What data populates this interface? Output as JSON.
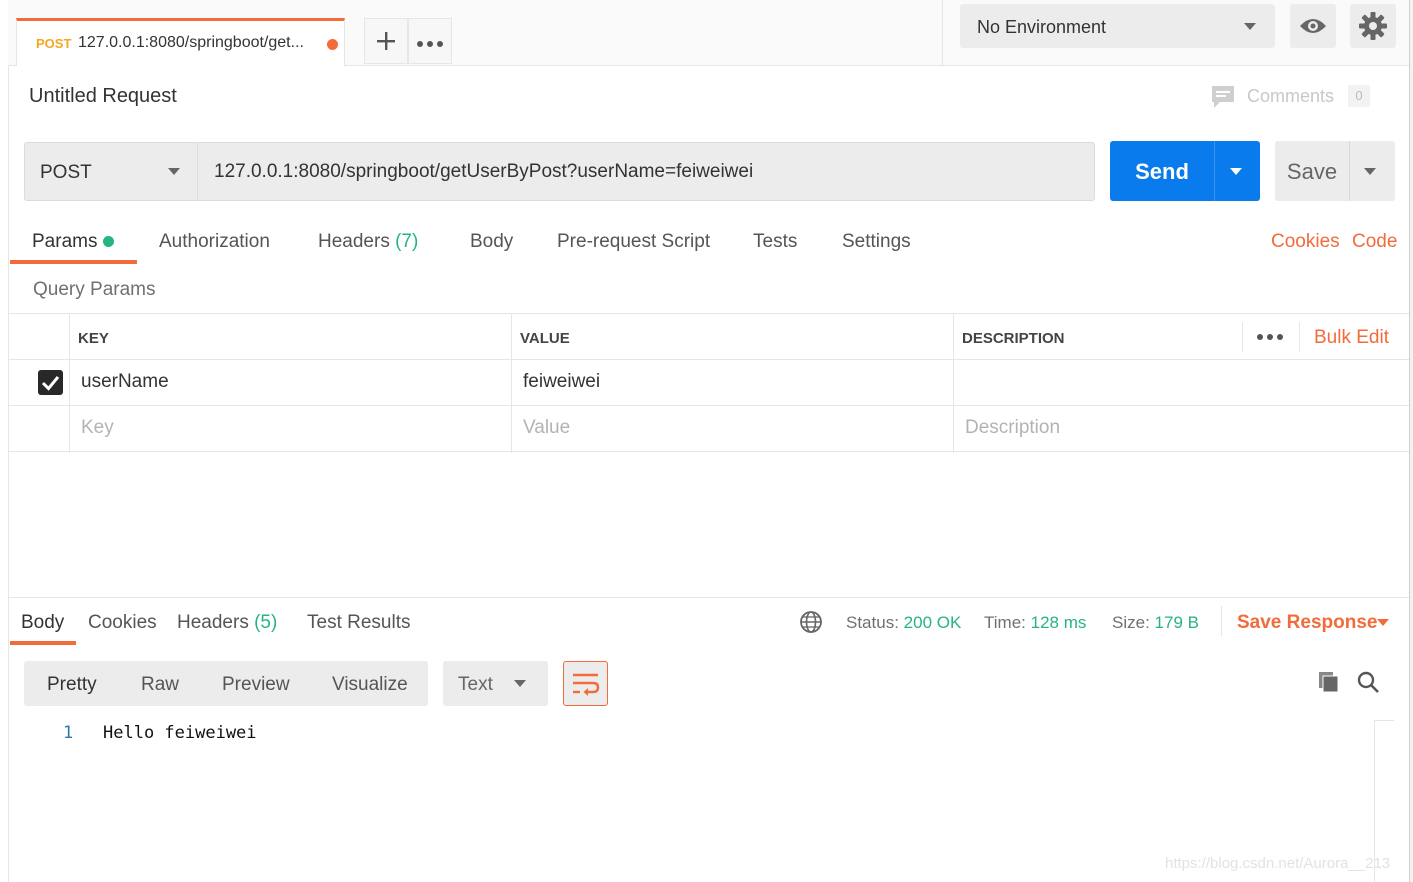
{
  "tabs": {
    "active": {
      "method": "POST",
      "title": "127.0.0.1:8080/springboot/get..."
    },
    "add_icon": "plus-icon",
    "more_icon": "ellipsis-icon"
  },
  "environment": {
    "selected": "No Environment"
  },
  "request": {
    "name": "Untitled Request",
    "comments_label": "Comments",
    "comments_count": "0",
    "method": "POST",
    "url": "127.0.0.1:8080/springboot/getUserByPost?userName=feiweiwei",
    "send_label": "Send",
    "save_label": "Save"
  },
  "request_tabs": {
    "params": "Params",
    "authorization": "Authorization",
    "headers": "Headers",
    "headers_count": "(7)",
    "body": "Body",
    "prerequest": "Pre-request Script",
    "tests": "Tests",
    "settings": "Settings",
    "cookies": "Cookies",
    "code": "Code"
  },
  "query_params": {
    "section_title": "Query Params",
    "columns": {
      "key": "KEY",
      "value": "VALUE",
      "description": "DESCRIPTION"
    },
    "bulk_edit": "Bulk Edit",
    "rows": [
      {
        "checked": true,
        "key": "userName",
        "value": "feiweiwei",
        "description": ""
      }
    ],
    "placeholders": {
      "key": "Key",
      "value": "Value",
      "description": "Description"
    }
  },
  "response_tabs": {
    "body": "Body",
    "cookies": "Cookies",
    "headers": "Headers",
    "headers_count": "(5)",
    "test_results": "Test Results"
  },
  "response_status": {
    "status_label": "Status:",
    "status_value": "200 OK",
    "time_label": "Time:",
    "time_value": "128 ms",
    "size_label": "Size:",
    "size_value": "179 B",
    "save_response": "Save Response"
  },
  "response_format": {
    "modes": [
      "Pretty",
      "Raw",
      "Preview",
      "Visualize"
    ],
    "type": "Text"
  },
  "response_body": {
    "line_number": "1",
    "line_text": "Hello feiweiwei"
  },
  "watermark": "https://blog.csdn.net/Aurora__213",
  "colors": {
    "accent": "#f26b3a",
    "send": "#097bed",
    "success": "#26b47f"
  }
}
